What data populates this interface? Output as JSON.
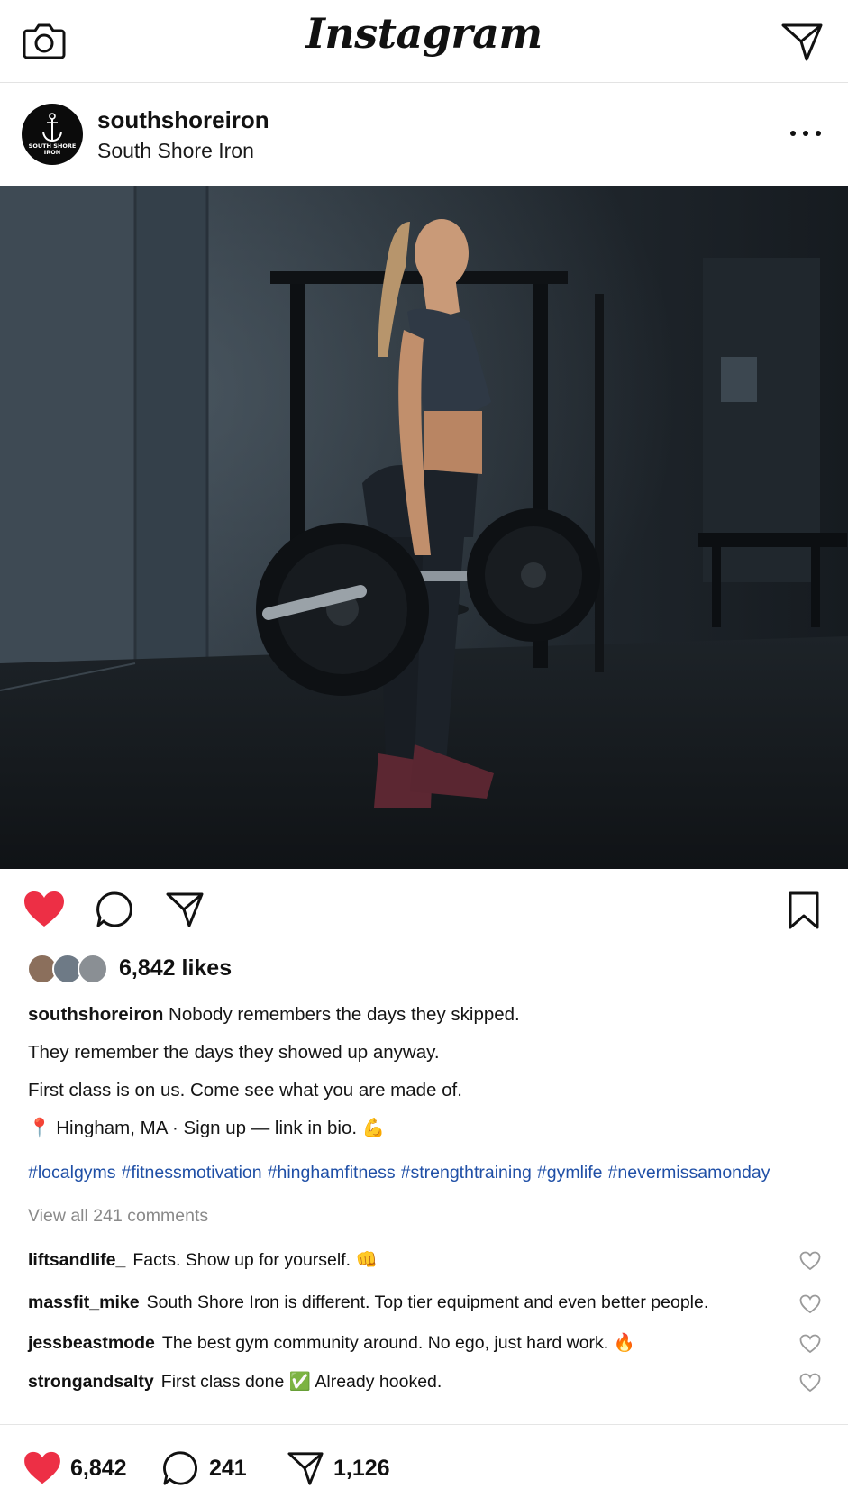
{
  "app": {
    "title": "Instagram"
  },
  "post": {
    "username": "southshoreiron",
    "full_name": "South Shore Iron",
    "avatar_text": "SOUTH SHORE IRON",
    "likes_label": "6,842 likes",
    "caption_username": "southshoreiron",
    "caption_lines": [
      "Nobody remembers the days they skipped.",
      "They remember the days they showed up anyway.",
      "First class is on us. Come see what you are made of.",
      "📍 Hingham, MA · Sign up — link in bio. 💪"
    ],
    "hashtags": [
      "#localgyms",
      "#fitnessmotivation",
      "#hinghamfitness",
      "#strengthtraining",
      "#gymlife",
      "#nevermissamonday"
    ],
    "view_all_comments": "View all 241 comments",
    "liked": true
  },
  "comments": [
    {
      "user": "liftsandlife_",
      "text": "Facts. Show up for yourself. 👊"
    },
    {
      "user": "massfit_mike",
      "text": "South Shore Iron is different. Top tier equipment and even better people."
    },
    {
      "user": "jessbeastmode",
      "text": "The best gym community around. No ego, just hard work. 🔥"
    },
    {
      "user": "strongandsalty",
      "text": "First class done ✅ Already hooked."
    }
  ],
  "stats": {
    "likes": "6,842",
    "comments": "241",
    "shares": "1,126"
  },
  "colors": {
    "heart": "#ed2f45",
    "hashtag": "#1f4fa6",
    "muted": "#8a8a8a"
  },
  "icons": [
    "camera-icon",
    "direct-send-icon",
    "more-icon",
    "heart-icon",
    "comment-icon",
    "share-icon",
    "bookmark-icon"
  ]
}
